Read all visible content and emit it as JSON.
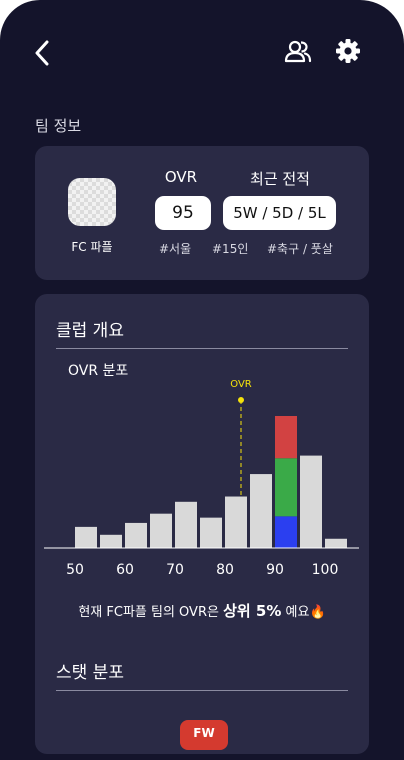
{
  "header": {
    "back_icon": "chevron-left-icon",
    "people_icon": "people-icon",
    "settings_icon": "gear-icon"
  },
  "team_info": {
    "section_label": "팀 정보",
    "team_name": "FC 파플",
    "ovr_label": "OVR",
    "ovr_value": "95",
    "record_label": "최근 전적",
    "record_value": "5W / 5D / 5L",
    "tags": [
      "#서울",
      "#15인",
      "#축구 / 풋살"
    ]
  },
  "overview": {
    "title": "클럽 개요",
    "chart_title": "OVR 분포",
    "marker_label": "OVR",
    "summary_prefix": "현재 FC파플 팀의 OVR은",
    "summary_highlight": "상위 5%",
    "summary_suffix": "예요🔥",
    "stat_title": "스탯 분포",
    "position_badge": "FW"
  },
  "colors": {
    "background": "#14142b",
    "card": "#2a2a45",
    "bar": "#d9d9d9",
    "marker": "#f5e20b",
    "red": "#d24242",
    "green": "#3aaa48",
    "blue": "#2b3ff0",
    "badge": "#d43a2f"
  },
  "chart_data": {
    "type": "bar",
    "title": "OVR 분포",
    "x_ticks": [
      "50",
      "60",
      "70",
      "80",
      "90",
      "100"
    ],
    "x_range": [
      45,
      105
    ],
    "y_range": [
      0,
      100
    ],
    "marker": {
      "label": "OVR",
      "x": 80
    },
    "bars": [
      {
        "x": 49,
        "value": 16
      },
      {
        "x": 54,
        "value": 10
      },
      {
        "x": 59,
        "value": 19
      },
      {
        "x": 64,
        "value": 26
      },
      {
        "x": 69,
        "value": 35
      },
      {
        "x": 74,
        "value": 23
      },
      {
        "x": 79,
        "value": 39
      },
      {
        "x": 84,
        "value": 56
      },
      {
        "x": 89,
        "value": 100,
        "stack": [
          {
            "color": "red",
            "value": 32
          },
          {
            "color": "green",
            "value": 44
          },
          {
            "color": "blue",
            "value": 24
          }
        ]
      },
      {
        "x": 94,
        "value": 70
      },
      {
        "x": 99,
        "value": 7
      }
    ]
  }
}
